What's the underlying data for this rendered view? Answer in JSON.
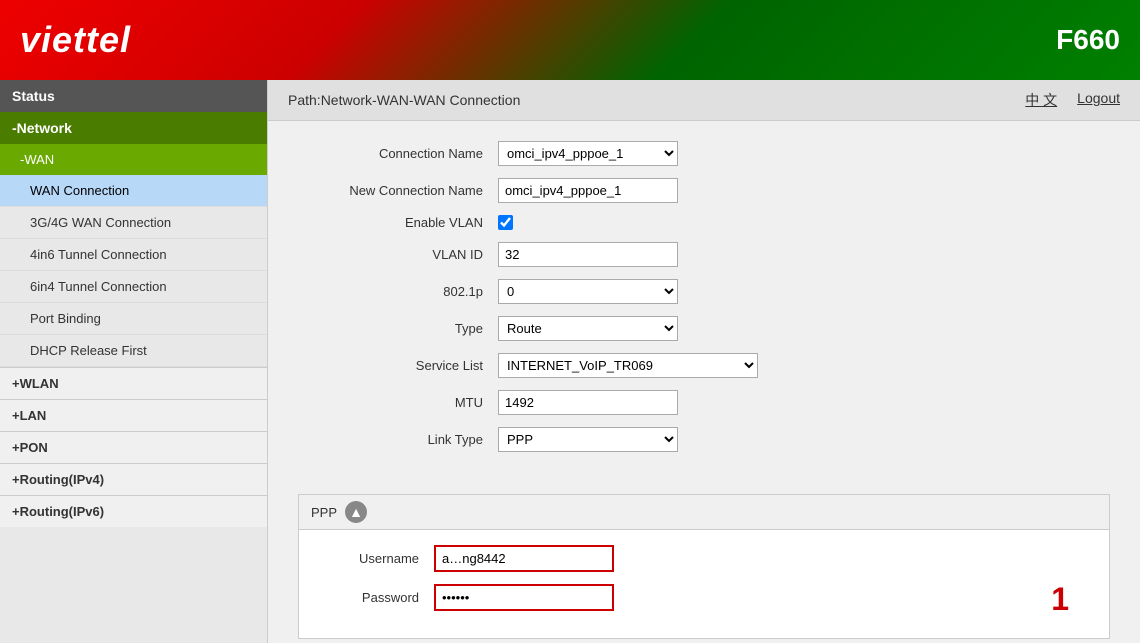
{
  "header": {
    "logo": "viettel",
    "model": "F660"
  },
  "path": {
    "text": "Path:Network-WAN-WAN Connection",
    "lang": "中 文",
    "logout": "Logout"
  },
  "sidebar": {
    "status_label": "Status",
    "network_label": "-Network",
    "wan_label": "-WAN",
    "items": [
      {
        "label": "WAN Connection",
        "active": true
      },
      {
        "label": "3G/4G WAN Connection",
        "active": false
      },
      {
        "label": "4in6 Tunnel Connection",
        "active": false
      },
      {
        "label": "6in4 Tunnel Connection",
        "active": false
      },
      {
        "label": "Port Binding",
        "active": false
      },
      {
        "label": "DHCP Release First",
        "active": false
      }
    ],
    "sections": [
      {
        "label": "+WLAN"
      },
      {
        "label": "+LAN"
      },
      {
        "label": "+PON"
      },
      {
        "label": "+Routing(IPv4)"
      },
      {
        "label": "+Routing(IPv6)"
      }
    ]
  },
  "form": {
    "connection_name_label": "Connection Name",
    "connection_name_value": "omci_ipv4_pppoe_1",
    "new_connection_name_label": "New Connection Name",
    "new_connection_name_value": "omci_ipv4_pppoe_1",
    "enable_vlan_label": "Enable VLAN",
    "vlan_id_label": "VLAN ID",
    "vlan_id_value": "32",
    "vlan_8021p_label": "802.1p",
    "vlan_8021p_value": "0",
    "type_label": "Type",
    "type_value": "Route",
    "service_list_label": "Service List",
    "service_list_value": "INTERNET_VoIP_TR069",
    "mtu_label": "MTU",
    "mtu_value": "1492",
    "link_type_label": "Link Type",
    "link_type_value": "PPP"
  },
  "ppp": {
    "section_label": "PPP",
    "username_label": "Username",
    "username_value": "a…ng8442",
    "password_label": "Password",
    "password_value": "••••••"
  },
  "annotation": {
    "number": "1"
  }
}
